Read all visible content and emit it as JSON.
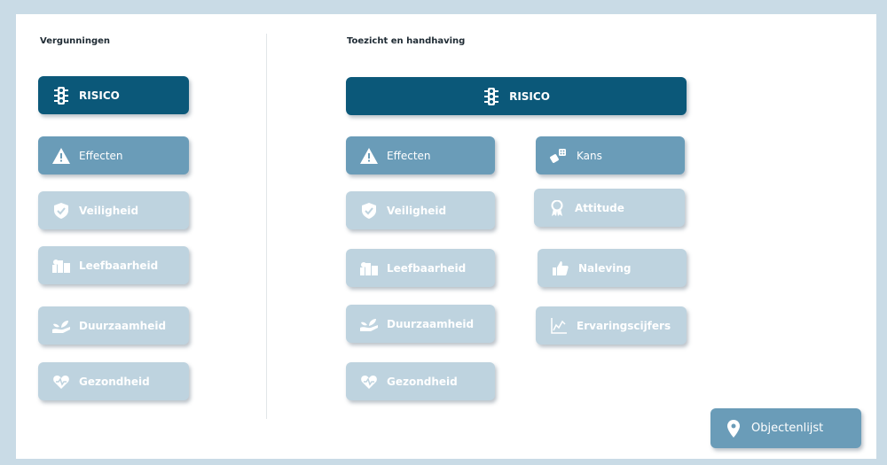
{
  "left_section": {
    "title": "Vergunningen",
    "risico": "RISICO",
    "effecten": "Effecten",
    "items": [
      "Veiligheid",
      "Leefbaarheid",
      "Duurzaamheid",
      "Gezondheid"
    ]
  },
  "right_section": {
    "title": "Toezicht en handhaving",
    "risico": "RISICO",
    "effecten": "Effecten",
    "kans": "Kans",
    "items": [
      "Veiligheid",
      "Leefbaarheid",
      "Duurzaamheid",
      "Gezondheid"
    ],
    "kans_items": [
      "Attitude",
      "Naleving",
      "Ervaringscijfers"
    ]
  },
  "objectenlijst": "Objectenlijst",
  "colors": {
    "background": "#c9dbe6",
    "dark": "#0b5879",
    "mid": "#6a9cb8",
    "light": "#bed3df"
  },
  "icons": {
    "risico": "traffic-light-icon",
    "effecten": "warning-icon",
    "kans": "dice-icon",
    "veiligheid": "shield-icon",
    "leefbaarheid": "city-icon",
    "duurzaamheid": "hand-plant-icon",
    "gezondheid": "heart-icon",
    "attitude": "award-icon",
    "naleving": "thumbs-up-icon",
    "ervaringscijfers": "line-chart-icon",
    "objectenlijst": "map-pin-icon"
  }
}
